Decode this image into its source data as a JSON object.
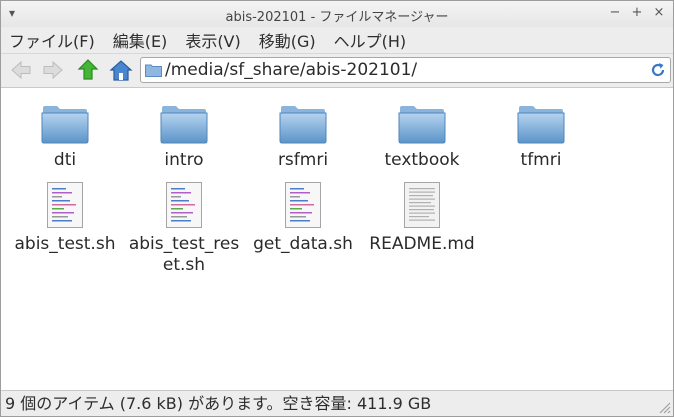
{
  "window": {
    "title": "abis-202101 - ファイルマネージャー",
    "menu_glyph": "▾",
    "minimize": "−",
    "maximize": "+",
    "close": "×"
  },
  "menubar": {
    "items": [
      {
        "label": "ファイル(F)"
      },
      {
        "label": "編集(E)"
      },
      {
        "label": "表示(V)"
      },
      {
        "label": "移動(G)"
      },
      {
        "label": "ヘルプ(H)"
      }
    ]
  },
  "toolbar": {
    "location_value": "/media/sf_share/abis-202101/",
    "colors": {
      "up_arrow": "#3bab2d",
      "home": "#3a78c3"
    }
  },
  "files": [
    {
      "name": "dti",
      "type": "folder"
    },
    {
      "name": "intro",
      "type": "folder"
    },
    {
      "name": "rsfmri",
      "type": "folder"
    },
    {
      "name": "textbook",
      "type": "folder"
    },
    {
      "name": "tfmri",
      "type": "folder"
    },
    {
      "name": "abis_test.sh",
      "type": "script"
    },
    {
      "name": "abis_test_reset.sh",
      "type": "script"
    },
    {
      "name": "get_data.sh",
      "type": "script"
    },
    {
      "name": "README.md",
      "type": "text"
    }
  ],
  "statusbar": {
    "text": "9 個のアイテム (7.6 kB) があります。空き容量: 411.9 GB"
  },
  "colors": {
    "folder_light": "#a9cbe9",
    "folder_dark": "#5b94c9",
    "background": "#ededed"
  }
}
